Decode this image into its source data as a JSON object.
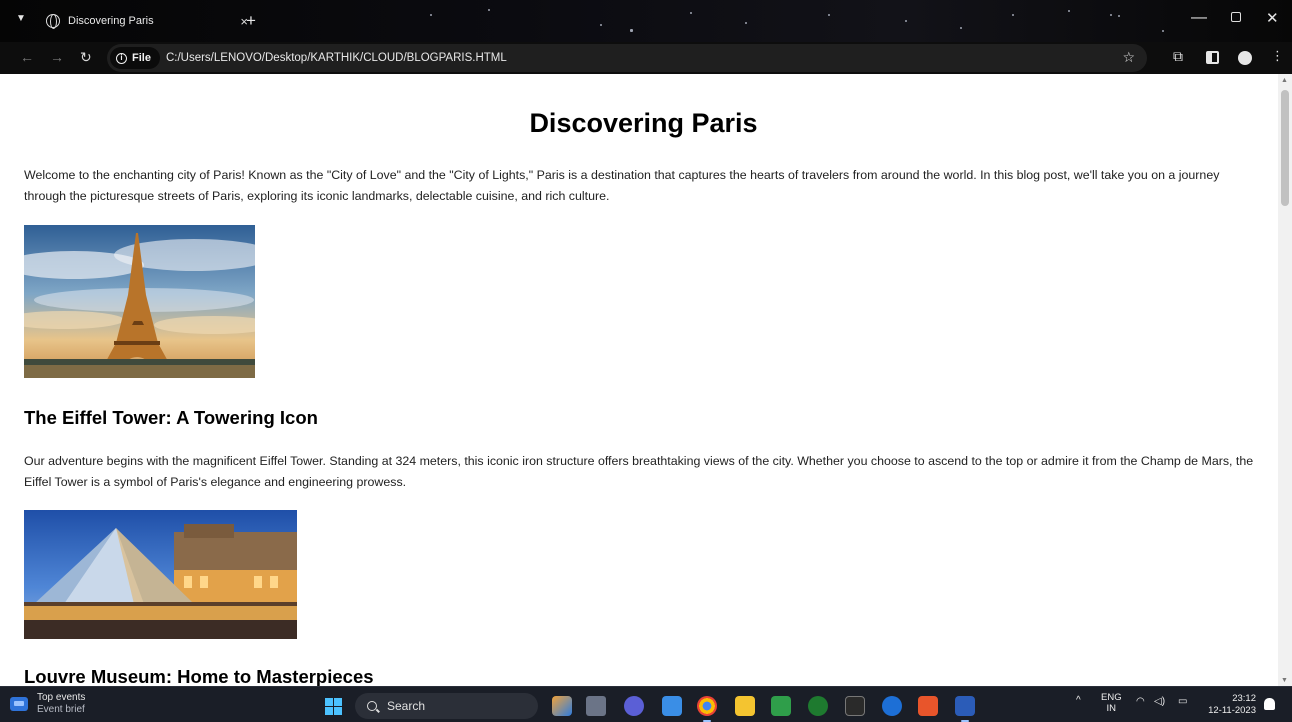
{
  "browser": {
    "tab_title": "Discovering Paris",
    "tab_close": "×",
    "new_tab": "+",
    "address_chip": "File",
    "url": "C:/Users/LENOVO/Desktop/KARTHIK/CLOUD/BLOGPARIS.HTML"
  },
  "page": {
    "title": "Discovering Paris",
    "intro": "Welcome to the enchanting city of Paris! Known as the \"City of Love\" and the \"City of Lights,\" Paris is a destination that captures the hearts of travelers from around the world. In this blog post, we'll take you on a journey through the picturesque streets of Paris, exploring its iconic landmarks, delectable cuisine, and rich culture.",
    "section1_heading": "The Eiffel Tower: A Towering Icon",
    "section1_text": "Our adventure begins with the magnificent Eiffel Tower. Standing at 324 meters, this iconic iron structure offers breathtaking views of the city. Whether you choose to ascend to the top or admire it from the Champ de Mars, the Eiffel Tower is a symbol of Paris's elegance and engineering prowess.",
    "section2_heading": "Louvre Museum: Home to Masterpieces"
  },
  "taskbar": {
    "widget_title": "Top events",
    "widget_subtitle": "Event brief",
    "search_label": "Search",
    "lang_top": "ENG",
    "lang_bottom": "IN",
    "time": "23:12",
    "date": "12-11-2023"
  },
  "colors": {
    "accent": "#4cc2ff",
    "taskbar_bg": "#1a1e27",
    "browser_frame": "#0d0d0d"
  }
}
